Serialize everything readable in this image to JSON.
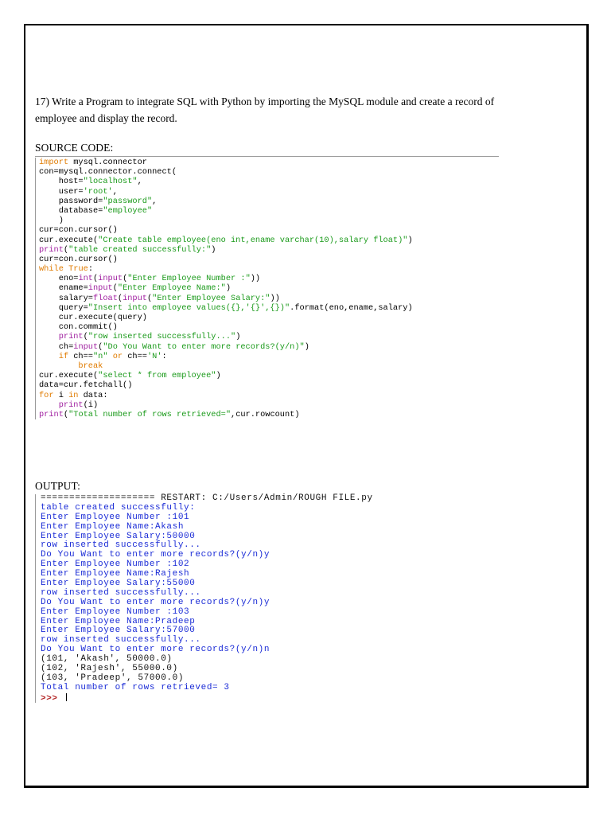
{
  "question": "17) Write a Program to integrate SQL with Python by importing the MySQL module and create a record of employee and display the record.",
  "headings": {
    "source": "SOURCE CODE:",
    "output": "OUTPUT:"
  },
  "code_lines": [
    [
      {
        "t": "kw",
        "v": "import"
      },
      {
        "t": "",
        "v": " mysql.connector"
      }
    ],
    [
      {
        "t": "",
        "v": "con=mysql.connector.connect("
      }
    ],
    [
      {
        "t": "",
        "v": "    host="
      },
      {
        "t": "st",
        "v": "\"localhost\""
      },
      {
        "t": "",
        "v": ","
      }
    ],
    [
      {
        "t": "",
        "v": "    user="
      },
      {
        "t": "st",
        "v": "'root'"
      },
      {
        "t": "",
        "v": ","
      }
    ],
    [
      {
        "t": "",
        "v": "    password="
      },
      {
        "t": "st",
        "v": "\"password\""
      },
      {
        "t": "",
        "v": ","
      }
    ],
    [
      {
        "t": "",
        "v": "    database="
      },
      {
        "t": "st",
        "v": "\"employee\""
      }
    ],
    [
      {
        "t": "",
        "v": "    )"
      }
    ],
    [
      {
        "t": "",
        "v": "cur=con.cursor()"
      }
    ],
    [
      {
        "t": "",
        "v": "cur.execute("
      },
      {
        "t": "st",
        "v": "\"Create table employee(eno int,ename varchar(10),salary float)\""
      },
      {
        "t": "",
        "v": ")"
      }
    ],
    [
      {
        "t": "bi",
        "v": "print"
      },
      {
        "t": "",
        "v": "("
      },
      {
        "t": "st",
        "v": "\"table created successfully:\""
      },
      {
        "t": "",
        "v": ")"
      }
    ],
    [
      {
        "t": "",
        "v": "cur=con.cursor()"
      }
    ],
    [
      {
        "t": "kw",
        "v": "while"
      },
      {
        "t": "",
        "v": " "
      },
      {
        "t": "kw",
        "v": "True"
      },
      {
        "t": "",
        "v": ":"
      }
    ],
    [
      {
        "t": "",
        "v": "    eno="
      },
      {
        "t": "bi",
        "v": "int"
      },
      {
        "t": "",
        "v": "("
      },
      {
        "t": "bi",
        "v": "input"
      },
      {
        "t": "",
        "v": "("
      },
      {
        "t": "st",
        "v": "\"Enter Employee Number :\""
      },
      {
        "t": "",
        "v": "))"
      }
    ],
    [
      {
        "t": "",
        "v": "    ename="
      },
      {
        "t": "bi",
        "v": "input"
      },
      {
        "t": "",
        "v": "("
      },
      {
        "t": "st",
        "v": "\"Enter Employee Name:\""
      },
      {
        "t": "",
        "v": ")"
      }
    ],
    [
      {
        "t": "",
        "v": "    salary="
      },
      {
        "t": "bi",
        "v": "float"
      },
      {
        "t": "",
        "v": "("
      },
      {
        "t": "bi",
        "v": "input"
      },
      {
        "t": "",
        "v": "("
      },
      {
        "t": "st",
        "v": "\"Enter Employee Salary:\""
      },
      {
        "t": "",
        "v": "))"
      }
    ],
    [
      {
        "t": "",
        "v": "    query="
      },
      {
        "t": "st",
        "v": "\"Insert into employee values({},'{}',{})\""
      },
      {
        "t": "",
        "v": ".format(eno,ename,salary)"
      }
    ],
    [
      {
        "t": "",
        "v": "    cur.execute(query)"
      }
    ],
    [
      {
        "t": "",
        "v": "    con.commit()"
      }
    ],
    [
      {
        "t": "bi",
        "v": "    print"
      },
      {
        "t": "",
        "v": "("
      },
      {
        "t": "st",
        "v": "\"row inserted successfully...\""
      },
      {
        "t": "",
        "v": ")"
      }
    ],
    [
      {
        "t": "",
        "v": "    ch="
      },
      {
        "t": "bi",
        "v": "input"
      },
      {
        "t": "",
        "v": "("
      },
      {
        "t": "st",
        "v": "\"Do You Want to enter more records?(y/n)\""
      },
      {
        "t": "",
        "v": ")"
      }
    ],
    [
      {
        "t": "kw",
        "v": "    if"
      },
      {
        "t": "",
        "v": " ch=="
      },
      {
        "t": "st",
        "v": "\"n\""
      },
      {
        "t": "",
        "v": " "
      },
      {
        "t": "kw",
        "v": "or"
      },
      {
        "t": "",
        "v": " ch=="
      },
      {
        "t": "st",
        "v": "'N'"
      },
      {
        "t": "",
        "v": ":"
      }
    ],
    [
      {
        "t": "kw",
        "v": "        break"
      }
    ],
    [
      {
        "t": "",
        "v": "cur.execute("
      },
      {
        "t": "st",
        "v": "\"select * from employee\""
      },
      {
        "t": "",
        "v": ")"
      }
    ],
    [
      {
        "t": "",
        "v": "data=cur.fetchall()"
      }
    ],
    [
      {
        "t": "kw",
        "v": "for"
      },
      {
        "t": "",
        "v": " i "
      },
      {
        "t": "kw",
        "v": "in"
      },
      {
        "t": "",
        "v": " data:"
      }
    ],
    [
      {
        "t": "bi",
        "v": "    print"
      },
      {
        "t": "",
        "v": "(i)"
      }
    ],
    [
      {
        "t": "bi",
        "v": "print"
      },
      {
        "t": "",
        "v": "("
      },
      {
        "t": "st",
        "v": "\"Total number of rows retrieved=\""
      },
      {
        "t": "",
        "v": ",cur.rowcount)"
      }
    ]
  ],
  "output_lines": [
    {
      "t": "in",
      "v": "==================== RESTART: C:/Users/Admin/ROUGH FILE.py"
    },
    {
      "t": "out",
      "v": "table created successfully:"
    },
    {
      "t": "out",
      "v": "Enter Employee Number :101"
    },
    {
      "t": "out",
      "v": "Enter Employee Name:Akash"
    },
    {
      "t": "out",
      "v": "Enter Employee Salary:50000"
    },
    {
      "t": "out",
      "v": "row inserted successfully..."
    },
    {
      "t": "out",
      "v": "Do You Want to enter more records?(y/n)y"
    },
    {
      "t": "out",
      "v": "Enter Employee Number :102"
    },
    {
      "t": "out",
      "v": "Enter Employee Name:Rajesh"
    },
    {
      "t": "out",
      "v": "Enter Employee Salary:55000"
    },
    {
      "t": "out",
      "v": "row inserted successfully..."
    },
    {
      "t": "out",
      "v": "Do You Want to enter more records?(y/n)y"
    },
    {
      "t": "out",
      "v": "Enter Employee Number :103"
    },
    {
      "t": "out",
      "v": "Enter Employee Name:Pradeep"
    },
    {
      "t": "out",
      "v": "Enter Employee Salary:57000"
    },
    {
      "t": "out",
      "v": "row inserted successfully..."
    },
    {
      "t": "out",
      "v": "Do You Want to enter more records?(y/n)n"
    },
    {
      "t": "in",
      "v": "(101, 'Akash', 50000.0)"
    },
    {
      "t": "in",
      "v": "(102, 'Rajesh', 55000.0)"
    },
    {
      "t": "in",
      "v": "(103, 'Pradeep', 57000.0)"
    },
    {
      "t": "out",
      "v": "Total number of rows retrieved= 3"
    }
  ],
  "prompt": ">>> ",
  "colors": {
    "keyword": "#e07b00",
    "builtin": "#a020a0",
    "string": "#1a9a1a",
    "shell_output": "#1a2bd6",
    "prompt": "#b22222"
  }
}
